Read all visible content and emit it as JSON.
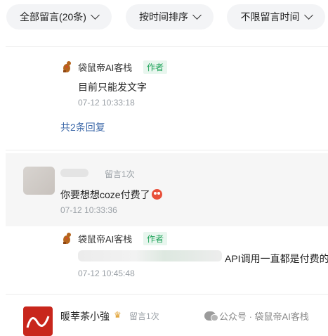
{
  "filters": {
    "all_comments": "全部留言(20条)",
    "sort_by_time": "按时间排序",
    "time_range": "不限留言时间"
  },
  "reply1": {
    "author": "袋鼠帝AI客栈",
    "author_tag": "作者",
    "text": "目前只能发文字",
    "time": "07-12 10:33:18"
  },
  "thread1": {
    "expand_replies": "共2条回复"
  },
  "comment2": {
    "meta": "留言1次",
    "text": "你要想想coze付费了",
    "time": "07-12 10:33:36"
  },
  "reply2": {
    "author": "袋鼠帝AI客栈",
    "author_tag": "作者",
    "text": "API调用一直都是付费的",
    "time": "07-12 10:45:48"
  },
  "comment3": {
    "author": "暖莘茶小強",
    "meta": "留言1次"
  },
  "watermark": {
    "text": "公众号 · 袋鼠帝AI客栈"
  },
  "colors": {
    "pill_bg": "#f3f4f6",
    "author_tag_green": "#1fa35a",
    "link_blue": "#3b67a8",
    "time_gray": "#9aa0a6",
    "highlight_bg": "#f6f6f6"
  }
}
